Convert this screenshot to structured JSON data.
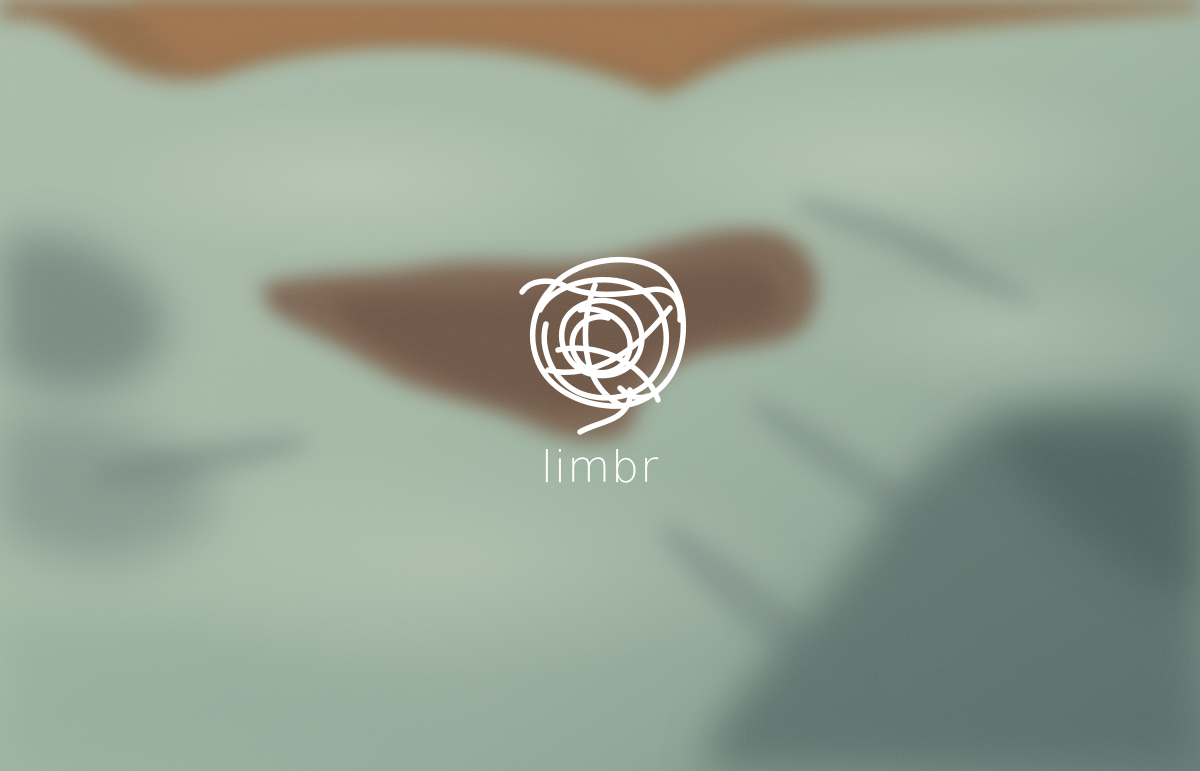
{
  "brand": {
    "name": "limbr",
    "logo_icon": "scribble-ball-icon",
    "text_color": "#ffffff"
  },
  "background": {
    "description_icon": "ocean-aerial-photo",
    "base_color": "#9fb3a3",
    "rock_color": "#7a4a2e",
    "deep_color": "#3f5554"
  }
}
